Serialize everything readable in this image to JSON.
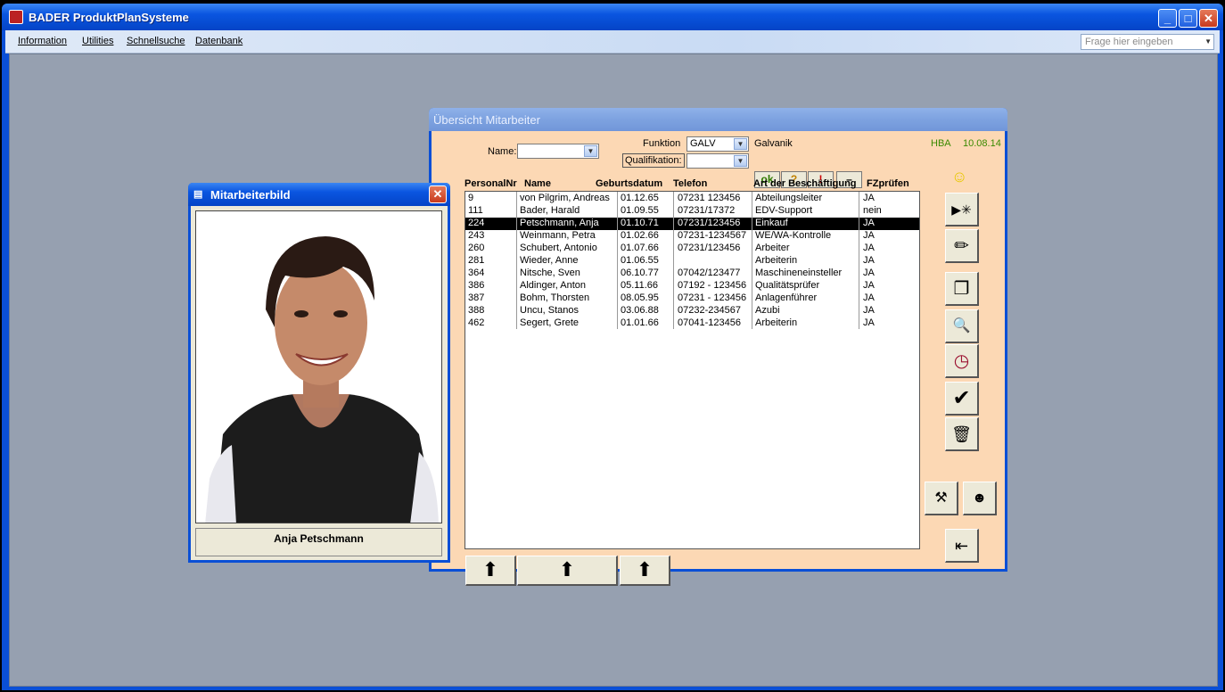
{
  "app": {
    "title": "BADER ProduktPlanSysteme"
  },
  "menu": {
    "items": [
      "Information",
      "Utilities",
      "Schnellsuche",
      "Datenbank"
    ]
  },
  "ask": {
    "placeholder": "Frage hier eingeben"
  },
  "uebersicht": {
    "title": "Übersicht Mitarbeiter",
    "name_label": "Name:",
    "name_value": "",
    "funktion_label": "Funktion",
    "funktion_value": "GALV",
    "funktion_text": "Galvanik",
    "qualifikation_label": "Qualifikation:",
    "qualifikation_value": "",
    "user": "HBA",
    "date": "10.08.14",
    "filter_buttons": [
      "ok",
      "?",
      "!",
      "–"
    ],
    "columns": [
      "PersonalNr",
      "Name",
      "Geburtsdatum",
      "Telefon",
      "Art der Beschäftigung",
      "FZprüfen"
    ],
    "rows": [
      {
        "nr": "9",
        "name": "von Pilgrim, Andreas",
        "geb": "01.12.65",
        "tel": "07231 123456",
        "art": "Abteilungsleiter",
        "fz": "JA"
      },
      {
        "nr": "111",
        "name": "Bader, Harald",
        "geb": "01.09.55",
        "tel": "07231/17372",
        "art": "EDV-Support",
        "fz": "nein"
      },
      {
        "nr": "224",
        "name": "Petschmann, Anja",
        "geb": "01.10.71",
        "tel": "07231/123456",
        "art": "Einkauf",
        "fz": "JA"
      },
      {
        "nr": "243",
        "name": "Weinmann, Petra",
        "geb": "01.02.66",
        "tel": "07231-1234567",
        "art": "WE/WA-Kontrolle",
        "fz": "JA"
      },
      {
        "nr": "260",
        "name": "Schubert, Antonio",
        "geb": "01.07.66",
        "tel": "07231/123456",
        "art": "Arbeiter",
        "fz": "JA"
      },
      {
        "nr": "281",
        "name": "Wieder, Anne",
        "geb": "01.06.55",
        "tel": "",
        "art": "Arbeiterin",
        "fz": "JA"
      },
      {
        "nr": "364",
        "name": "Nitsche, Sven",
        "geb": "06.10.77",
        "tel": "07042/123477",
        "art": "Maschineneinsteller",
        "fz": "JA"
      },
      {
        "nr": "386",
        "name": "Aldinger, Anton",
        "geb": "05.11.66",
        "tel": "07192 - 123456",
        "art": "Qualitätsprüfer",
        "fz": "JA"
      },
      {
        "nr": "387",
        "name": "Bohm, Thorsten",
        "geb": "08.05.95",
        "tel": "07231 - 123456",
        "art": "Anlagenführer",
        "fz": "JA"
      },
      {
        "nr": "388",
        "name": "Uncu, Stanos",
        "geb": "03.06.88",
        "tel": "07232-234567",
        "art": "Azubi",
        "fz": "JA"
      },
      {
        "nr": "462",
        "name": "Segert, Grete",
        "geb": "01.01.66",
        "tel": "07041-123456",
        "art": "Arbeiterin",
        "fz": "JA"
      }
    ],
    "selected_nr": "224"
  },
  "bild": {
    "title": "Mitarbeiterbild",
    "caption": "Anja Petschmann"
  },
  "colors": {
    "form_bg": "#fcd8b4",
    "accent_green": "#3a8a00",
    "xp_blue": "#0a4fd6"
  }
}
